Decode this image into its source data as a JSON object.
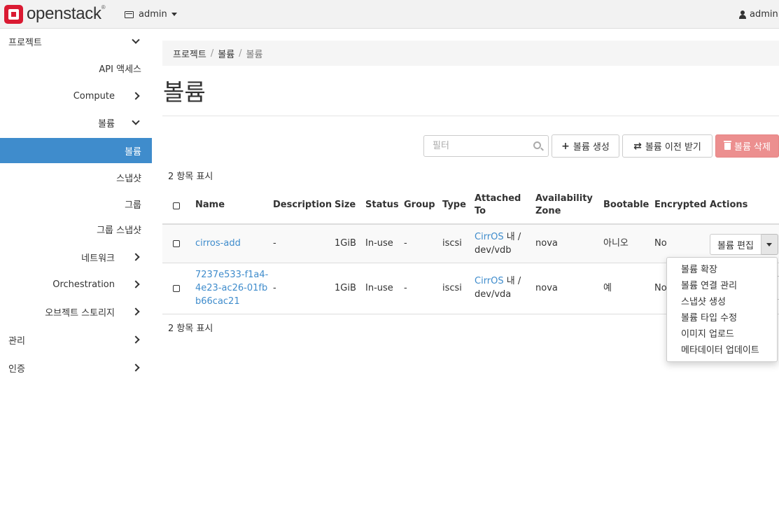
{
  "header": {
    "logo_text": "openstack",
    "logo_reg": "®",
    "project_label": "admin",
    "user_label": "admin"
  },
  "sidebar": {
    "items": [
      {
        "label": "프로젝트",
        "level": "top",
        "chevron": "down"
      },
      {
        "label": "API 액세스",
        "level": "sub",
        "chevron": "none"
      },
      {
        "label": "Compute",
        "level": "sub",
        "chevron": "right"
      },
      {
        "label": "볼륨",
        "level": "sub",
        "chevron": "down"
      },
      {
        "label": "볼륨",
        "level": "leaf",
        "chevron": "none",
        "active": true
      },
      {
        "label": "스냅샷",
        "level": "leaf",
        "chevron": "none"
      },
      {
        "label": "그룹",
        "level": "leaf",
        "chevron": "none"
      },
      {
        "label": "그룹 스냅샷",
        "level": "leaf",
        "chevron": "none"
      },
      {
        "label": "네트워크",
        "level": "sub",
        "chevron": "right"
      },
      {
        "label": "Orchestration",
        "level": "sub",
        "chevron": "right"
      },
      {
        "label": "오브젝트 스토리지",
        "level": "sub",
        "chevron": "right"
      },
      {
        "label": "관리",
        "level": "top",
        "chevron": "right"
      },
      {
        "label": "인증",
        "level": "top",
        "chevron": "right"
      }
    ]
  },
  "breadcrumb": {
    "items": [
      "프로젝트",
      "볼륨",
      "볼륨"
    ],
    "separator": "/"
  },
  "page": {
    "title": "볼륨"
  },
  "toolbar": {
    "filter_placeholder": "필터",
    "create_label": "볼륨 생성",
    "transfer_label": "볼륨 이전 받기",
    "delete_label": "볼륨 삭제"
  },
  "table": {
    "count_top": "2 항목 표시",
    "count_bottom": "2 항목 표시",
    "columns": {
      "name": "Name",
      "description": "Description",
      "size": "Size",
      "status": "Status",
      "group": "Group",
      "type": "Type",
      "attached_to_1": "Attached",
      "attached_to_2": "To",
      "az_1": "Availability",
      "az_2": "Zone",
      "bootable": "Bootable",
      "encrypted": "Encrypted",
      "actions": "Actions"
    },
    "rows": [
      {
        "name_lines": [
          "cirros-add"
        ],
        "description": "-",
        "size": "1GiB",
        "status": "In-use",
        "group": "-",
        "type": "iscsi",
        "attached_link": "CirrOS",
        "attached_suffix": " 내 /",
        "attached_device": "dev/vdb",
        "az": "nova",
        "bootable": "아니오",
        "encrypted": "No",
        "action_label": "볼륨 편집"
      },
      {
        "name_lines": [
          "7237e533-f1a4-",
          "4e23-ac26-01fb",
          "b66cac21"
        ],
        "description": "-",
        "size": "1GiB",
        "status": "In-use",
        "group": "-",
        "type": "iscsi",
        "attached_link": "CirrOS",
        "attached_suffix": " 내 /",
        "attached_device": "dev/vda",
        "az": "nova",
        "bootable": "예",
        "encrypted": "No"
      }
    ]
  },
  "dropdown": {
    "items": [
      "볼륨 확장",
      "볼륨 연결 관리",
      "스냅샷 생성",
      "볼륨 타입 수정",
      "이미지 업로드",
      "메타데이터 업데이트"
    ]
  },
  "colors": {
    "accent": "#3f8ccc",
    "danger": "#ec8f8f",
    "brand": "#da1a32"
  }
}
